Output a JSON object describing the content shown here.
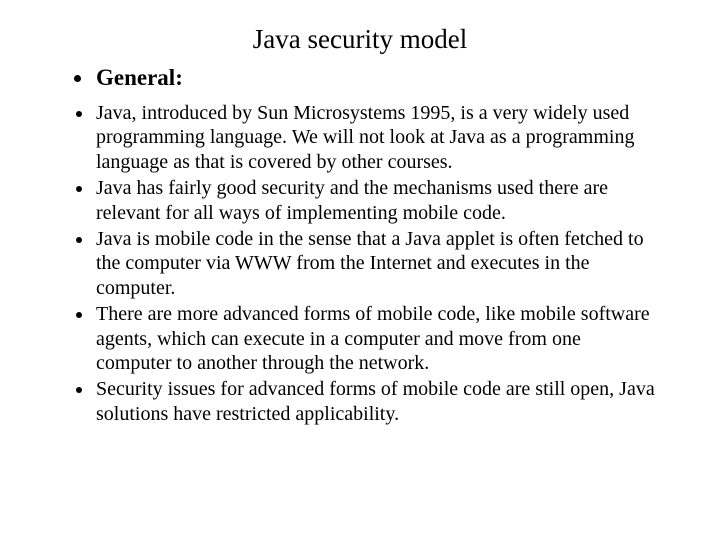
{
  "slide": {
    "title": "Java security model",
    "heading": "General:",
    "bullets": [
      "Java, introduced by Sun Microsystems 1995, is a very widely used programming language. We will not look at Java as a programming language as that is covered by other courses.",
      "Java has fairly good security and the mechanisms used there are relevant for all ways of implementing mobile code.",
      "Java is mobile code in the sense that a Java applet is often fetched to the computer via WWW from the Internet and executes in the computer.",
      "There are more advanced forms of mobile code, like mobile software agents, which can execute in a computer and move from one computer to another through the network.",
      "Security issues for advanced forms of mobile code are still open, Java solutions have restricted applicability."
    ]
  }
}
